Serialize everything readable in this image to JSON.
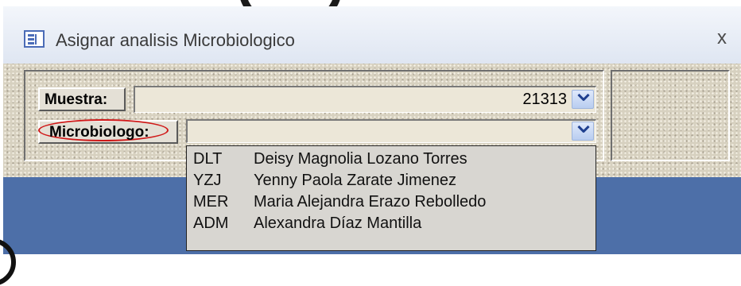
{
  "window": {
    "title": "Asignar analisis Microbiologico",
    "close_glyph": "x",
    "icon": "form-icon",
    "close_icon": "close-icon"
  },
  "muestra": {
    "label": "Muestra:",
    "value": "21313",
    "dropdown_icon": "chevron-down-icon"
  },
  "microbiologo": {
    "label": "Microbiologo:",
    "value": "",
    "dropdown_icon": "chevron-down-icon"
  },
  "dropdown": {
    "options": [
      {
        "code": "DLT",
        "name": "Deisy Magnolia Lozano Torres"
      },
      {
        "code": "YZJ",
        "name": "Yenny Paola Zarate Jimenez"
      },
      {
        "code": "MER",
        "name": "Maria Alejandra Erazo Rebolledo"
      },
      {
        "code": "ADM",
        "name": "Alexandra Díaz Mantilla"
      }
    ]
  },
  "colors": {
    "title_bar": "#e6ebf5",
    "window_frame": "#4d6fa8",
    "form_background": "#d7d1c0",
    "annotation_ellipse": "#d01818"
  }
}
